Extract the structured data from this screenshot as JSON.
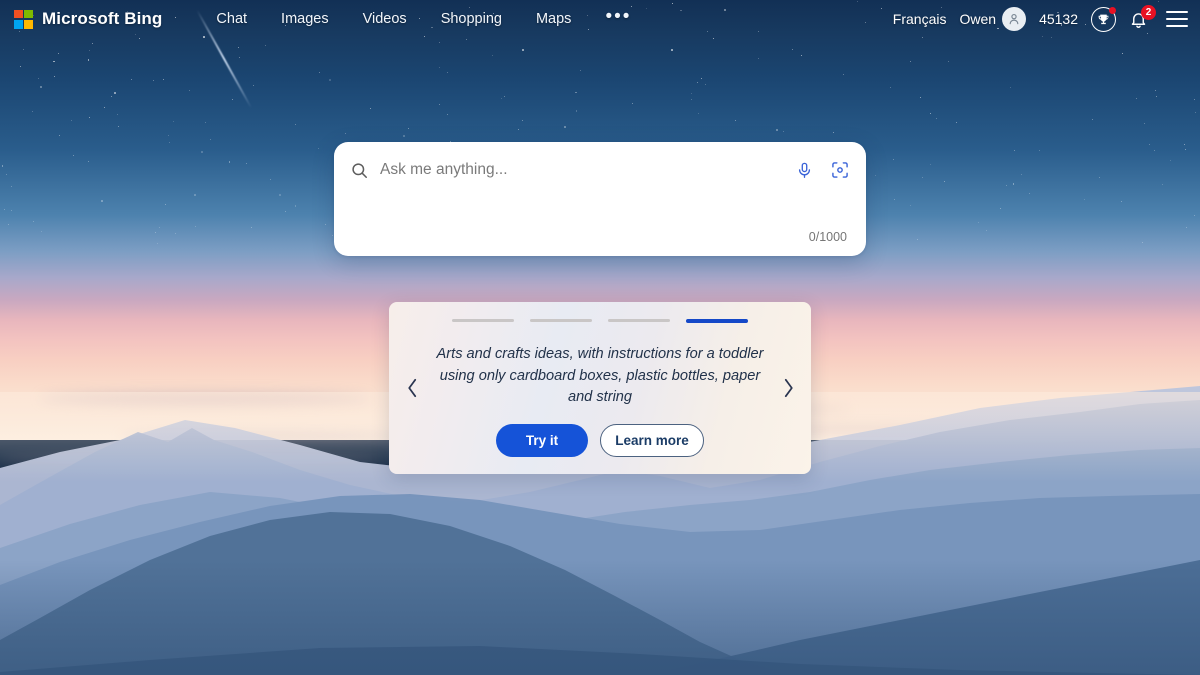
{
  "header": {
    "brand_name": "Microsoft Bing",
    "logo_icon": "microsoft-logo-icon",
    "nav": [
      {
        "label": "Chat"
      },
      {
        "label": "Images"
      },
      {
        "label": "Videos"
      },
      {
        "label": "Shopping"
      },
      {
        "label": "Maps"
      }
    ],
    "more_label": "•••",
    "language": "Français",
    "user_name": "Owen",
    "avatar_icon": "person-avatar-icon",
    "rewards_points": "45132",
    "rewards_icon": "trophy-icon",
    "rewards_has_alert": true,
    "notifications_icon": "bell-icon",
    "notifications_badge": "2",
    "menu_icon": "hamburger-menu-icon"
  },
  "search": {
    "placeholder": "Ask me anything...",
    "value": "",
    "search_icon": "search-icon",
    "mic_icon": "microphone-icon",
    "camera_icon": "visual-search-camera-icon",
    "char_count": "0/1000"
  },
  "carousel": {
    "slides_total": 4,
    "active_slide": 4,
    "prompt": "Arts and crafts ideas, with instructions for a toddler using only cardboard boxes, plastic bottles, paper and string",
    "try_label": "Try it",
    "learn_label": "Learn more",
    "prev_icon": "chevron-left-icon",
    "next_icon": "chevron-right-icon"
  },
  "colors": {
    "accent_blue": "#1553d8",
    "progress_active": "#1448c8",
    "badge_red": "#e81123",
    "ms_red": "#f25022",
    "ms_green": "#7fba00",
    "ms_blue": "#00a4ef",
    "ms_yellow": "#ffb900"
  },
  "background": {
    "scene": "sunset-mountain-landscape",
    "sky": "starry-night-to-pink-sunset-gradient"
  }
}
